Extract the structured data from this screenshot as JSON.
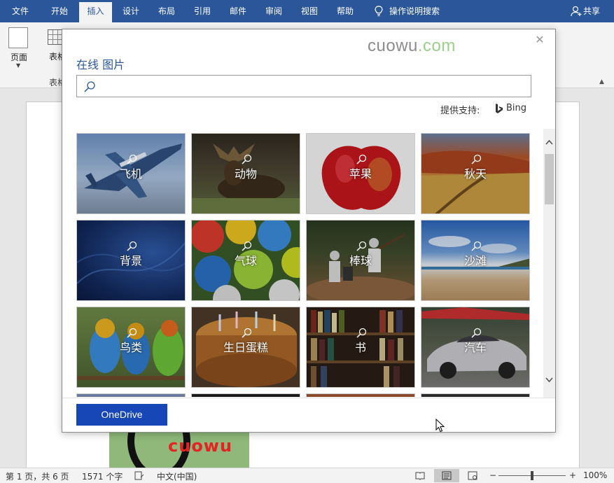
{
  "tabs": [
    {
      "label": "文件",
      "active": false
    },
    {
      "label": "开始",
      "active": false
    },
    {
      "label": "插入",
      "active": true
    },
    {
      "label": "设计",
      "active": false
    },
    {
      "label": "布局",
      "active": false
    },
    {
      "label": "引用",
      "active": false
    },
    {
      "label": "邮件",
      "active": false
    },
    {
      "label": "审阅",
      "active": false
    },
    {
      "label": "视图",
      "active": false
    },
    {
      "label": "帮助",
      "active": false
    }
  ],
  "tell_me": {
    "label": "操作说明搜索",
    "icon": "lightbulb-icon"
  },
  "share": {
    "label": "共享",
    "icon": "person-icon"
  },
  "ribbon": {
    "pages_label": "页面",
    "table_label": "表格",
    "table_group_label": "表格"
  },
  "dialog": {
    "title": "在线 图片",
    "watermark": {
      "main": "cuowu",
      "dot": ".",
      "suffix": "com"
    },
    "search_value": "",
    "provided_by": "提供支持:",
    "provider": "Bing",
    "tiles": [
      {
        "label": "飞机",
        "icon": "airplane"
      },
      {
        "label": "动物",
        "icon": "moose"
      },
      {
        "label": "苹果",
        "icon": "apple"
      },
      {
        "label": "秋天",
        "icon": "autumn-field"
      },
      {
        "label": "背景",
        "icon": "blue-abstract"
      },
      {
        "label": "气球",
        "icon": "balloons"
      },
      {
        "label": "棒球",
        "icon": "baseball-players"
      },
      {
        "label": "沙滩",
        "icon": "beach"
      },
      {
        "label": "鸟类",
        "icon": "parrots"
      },
      {
        "label": "生日蛋糕",
        "icon": "birthday-cake"
      },
      {
        "label": "书",
        "icon": "bookshelf"
      },
      {
        "label": "汽车",
        "icon": "sports-car"
      }
    ],
    "onedrive_label": "OneDrive"
  },
  "document": {
    "image_text": "cuowu"
  },
  "status": {
    "page": "第 1 页，共 6 页",
    "words": "1571 个字",
    "language": "中文(中国)",
    "zoom": "100%",
    "zoom_minus": "−",
    "zoom_plus": "+"
  },
  "colors": {
    "brand": "#2b579a",
    "onedrive_button": "#1746b6",
    "watermark_gray": "#8c8c8c",
    "watermark_green": "#9bcf8a",
    "document_image_text": "#e52323"
  }
}
